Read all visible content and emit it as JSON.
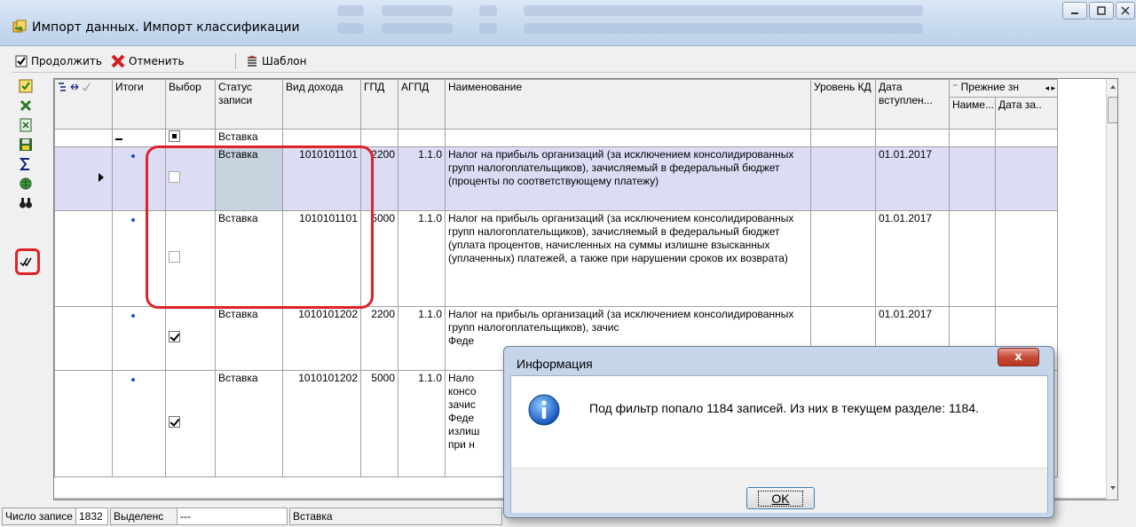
{
  "window": {
    "title": "Импорт данных. Импорт классификации"
  },
  "toolbar": {
    "continue_label": "Продолжить",
    "cancel_label": "Отменить",
    "template_label": "Шаблон"
  },
  "grid": {
    "headers": {
      "itogi": "Итоги",
      "vybor": "Выбор",
      "status": "Статус записи",
      "vid_dohoda": "Вид дохода",
      "gpd": "ГПД",
      "agpd": "АГПД",
      "name": "Наименование",
      "level": "Уровень КД",
      "date": "Дата вступлен...",
      "prev_group": "Прежние зн",
      "prev_name": "Наиме...",
      "prev_date": "Дата за.."
    },
    "group_row": {
      "status": "Вставка"
    },
    "rows": [
      {
        "status": "Вставка",
        "code": "1010101101",
        "gpd": "2200",
        "agpd": "1.1.0",
        "name": "Налог на прибыль организаций (за исключением консолидированных групп налогоплательщиков), зачисляемый в федеральный бюджет (проценты по соответствующему платежу)",
        "date": "01.01.2017",
        "checked": false
      },
      {
        "status": "Вставка",
        "code": "1010101101",
        "gpd": "5000",
        "agpd": "1.1.0",
        "name": "Налог на прибыль организаций (за исключением консолидированных групп налогоплательщиков), зачисляемый в федеральный бюджет (уплата процентов, начисленных на суммы излишне взысканных (уплаченных) платежей, а также при нарушении сроков их возврата)",
        "date": "01.01.2017",
        "checked": false
      },
      {
        "status": "Вставка",
        "code": "1010101202",
        "gpd": "2200",
        "agpd": "1.1.0",
        "name": "Налог на прибыль организаций (за исключением консолидированных групп налогоплательщиков), зачис",
        "name_tail": "Феде",
        "date": "01.01.2017",
        "checked": true
      },
      {
        "status": "Вставка",
        "code": "1010101202",
        "gpd": "5000",
        "agpd": "1.1.0",
        "name_lines": [
          "Нало",
          "консо",
          "зачис",
          "Феде",
          "излиш",
          "при н"
        ],
        "checked": true
      }
    ]
  },
  "statusbar": {
    "count_label": "Число записе",
    "count_value": "1832",
    "selected_label": "Выделенс",
    "selected_value": "---",
    "mode_value": "Вставка"
  },
  "dialog": {
    "title": "Информация",
    "message": "Под фильтр попало 1184 записей. Из них в текущем разделе: 1184.",
    "ok_label": "OK",
    "close_label": "x"
  },
  "colors": {
    "highlight_box": "#e0222a",
    "selected_row": "#dcdcf5"
  }
}
